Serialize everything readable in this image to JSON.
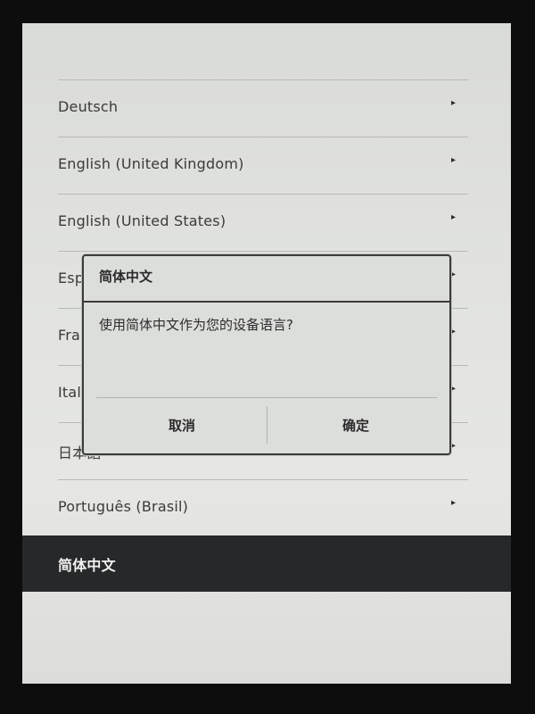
{
  "languages": [
    {
      "label": "Deutsch",
      "arrow": "▸"
    },
    {
      "label": "English (United Kingdom)",
      "arrow": "▸"
    },
    {
      "label": "English (United States)",
      "arrow": "▸"
    },
    {
      "label": "Español",
      "arrow": "▸"
    },
    {
      "label": "Français",
      "arrow": "▸"
    },
    {
      "label": "Italiano",
      "arrow": "▸"
    },
    {
      "label": "日本語",
      "arrow": "▸"
    },
    {
      "label": "Português (Brasil)",
      "arrow": "▸"
    },
    {
      "label": "简体中文",
      "arrow": ""
    }
  ],
  "selected_language": "简体中文",
  "dialog": {
    "title": "简体中文",
    "message": "使用简体中文作为您的设备语言?",
    "cancel_label": "取消",
    "confirm_label": "确定"
  },
  "colors": {
    "screen_bg": "#e2e3df",
    "selected_row_bg": "#262829",
    "text": "#3a3b3a"
  }
}
